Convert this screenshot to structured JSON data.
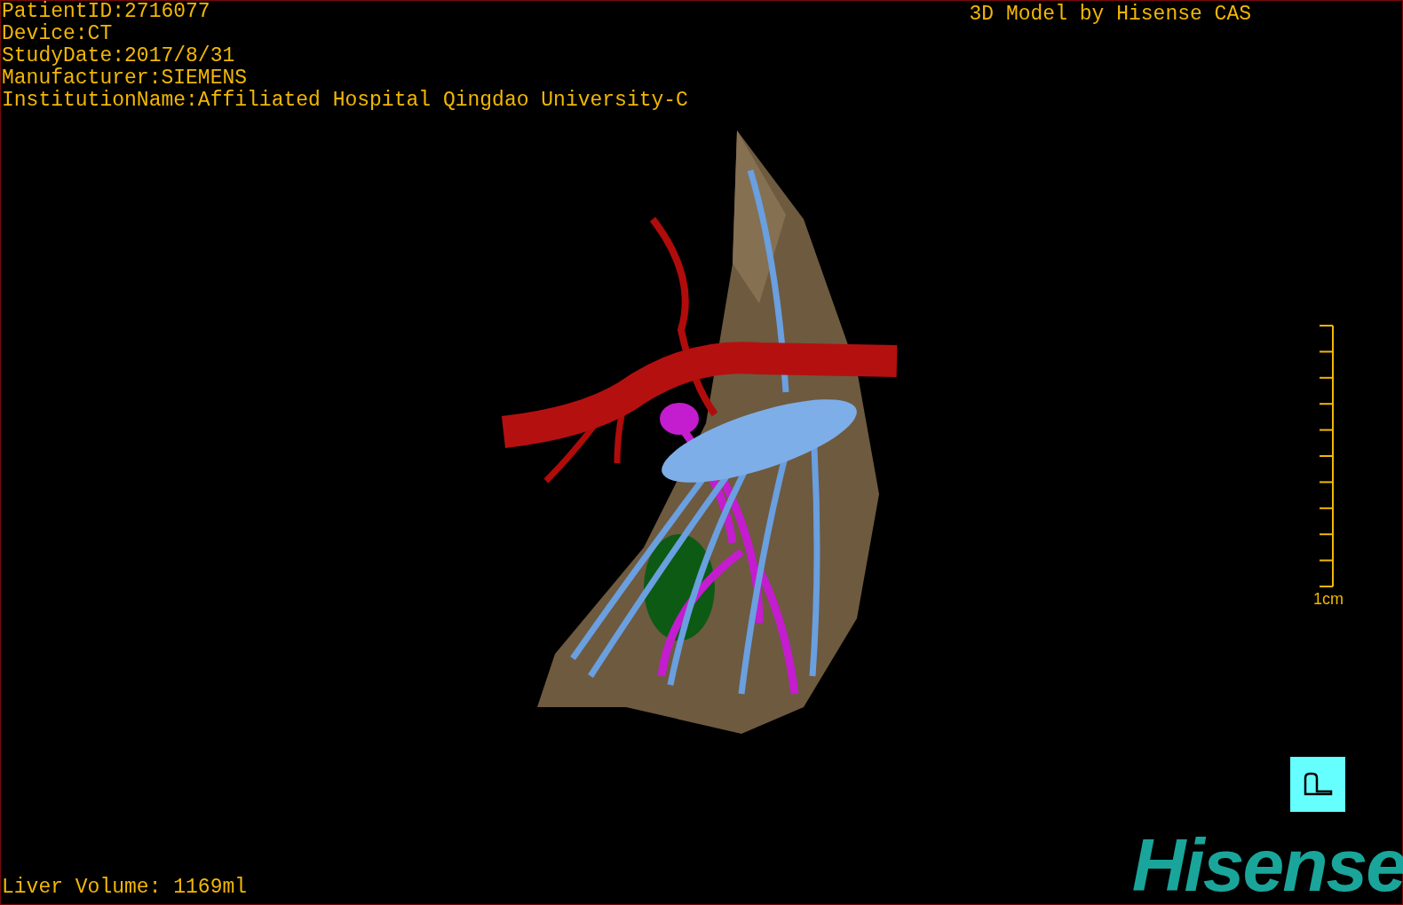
{
  "patient_info": [
    "PatientID:2716077",
    "Device:CT",
    "StudyDate:2017/8/31",
    "Manufacturer:SIEMENS",
    "InstitutionName:Affiliated Hospital Qingdao University-C"
  ],
  "title": "3D Model by Hisense CAS",
  "scale": {
    "label": "1cm"
  },
  "liver_volume": "Liver Volume: 1169ml",
  "logo": "Hisense"
}
